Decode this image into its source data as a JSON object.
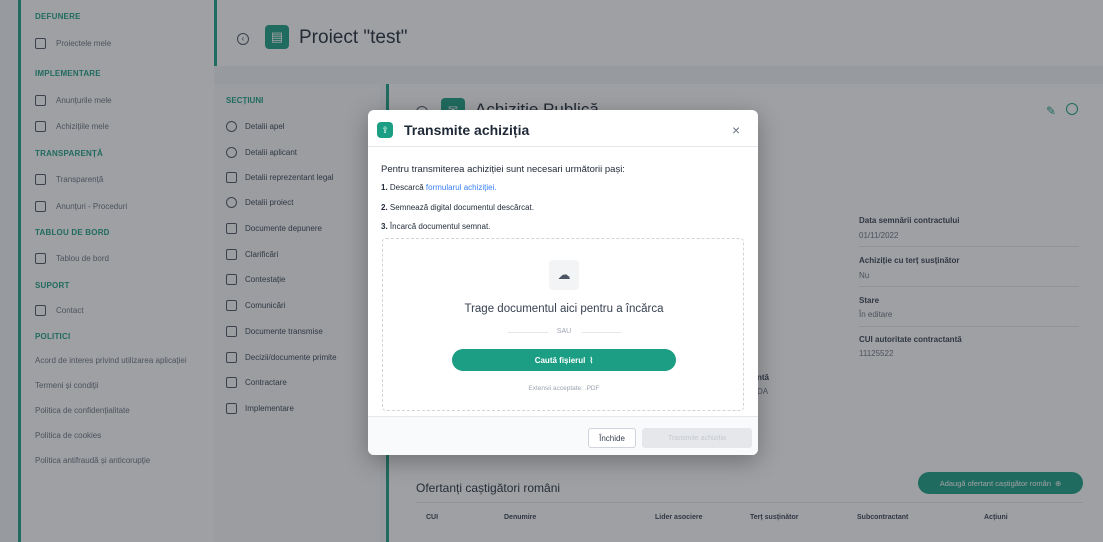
{
  "nav": {
    "sections": [
      {
        "head": "DEFUNERE",
        "items": [
          {
            "label": "Proiectele mele",
            "icon": "clipboard-icon"
          }
        ]
      },
      {
        "head": "IMPLEMENTARE",
        "items": [
          {
            "label": "Anunțurile mele",
            "icon": "folder-icon"
          },
          {
            "label": "Achizițiile mele",
            "icon": "document-icon"
          }
        ]
      },
      {
        "head": "TRANSPARENȚĂ",
        "items": [
          {
            "label": "Transparență",
            "icon": "table-icon"
          },
          {
            "label": "Anunțuri - Proceduri",
            "icon": "copy-icon"
          }
        ]
      },
      {
        "head": "TABLOU DE BORD",
        "items": [
          {
            "label": "Tablou de bord",
            "icon": "monitor-icon"
          }
        ]
      },
      {
        "head": "SUPORT",
        "items": [
          {
            "label": "Contact",
            "icon": "mail-icon"
          }
        ]
      },
      {
        "head": "POLITICI",
        "items": []
      }
    ],
    "policy_links": [
      "Acord de interes privind utilizarea aplicației",
      "Termeni și condiții",
      "Politica de confidențialitate",
      "Politica de cookies",
      "Politica antifraudă și anticorupție"
    ]
  },
  "header": {
    "title": "Proiect \"test\""
  },
  "sections_panel": {
    "title": "SECȚIUNI",
    "items": [
      "Detalii apel",
      "Detalii aplicant",
      "Detalii reprezentant legal",
      "Detalii proiect",
      "Documente depunere",
      "Clarificări",
      "Contestație",
      "Comunicări",
      "Documente transmise",
      "Decizii/documente primite",
      "Contractare",
      "Implementare"
    ]
  },
  "main": {
    "title": "Achiziție Publică",
    "fields": [
      {
        "label": "Data semnării contractului",
        "value": "01/11/2022"
      },
      {
        "label": "Achiziție cu terț susținător",
        "value": "Nu"
      },
      {
        "label": "Stare",
        "value": "În editare"
      },
      {
        "label": "CUI autoritate contractantă",
        "value": "11125522"
      }
    ],
    "partial_left": [
      "ntă",
      "DA"
    ],
    "bidders": {
      "title": "Ofertanți caștigători români",
      "add_button": "Adaugă ofertant caștigător român",
      "columns": [
        "CUI",
        "Denumire",
        "Lider asociere",
        "Terț susținător",
        "Subcontractant",
        "Acțiuni"
      ]
    }
  },
  "modal": {
    "title": "Transmite achiziția",
    "intro": "Pentru transmiterea achiziției sunt necesari următorii pași:",
    "step1_num": "1.",
    "step1_text": "Descarcă ",
    "step1_link": "formularul achiziției.",
    "step2_num": "2.",
    "step2_text": "Semnează digital documentul descărcat.",
    "step3_num": "3.",
    "step3_text": "Încarcă documentul semnat.",
    "drop_text": "Trage documentul aici pentru a încărca",
    "or_text": "SAU",
    "browse_button": "Caută fișierul",
    "accepted": "Extensii acceptate: .PDF",
    "close_button": "Închide",
    "submit_button": "Transmite achiziția"
  },
  "colors": {
    "accent": "#1b9e84",
    "link": "#3b82f6"
  }
}
